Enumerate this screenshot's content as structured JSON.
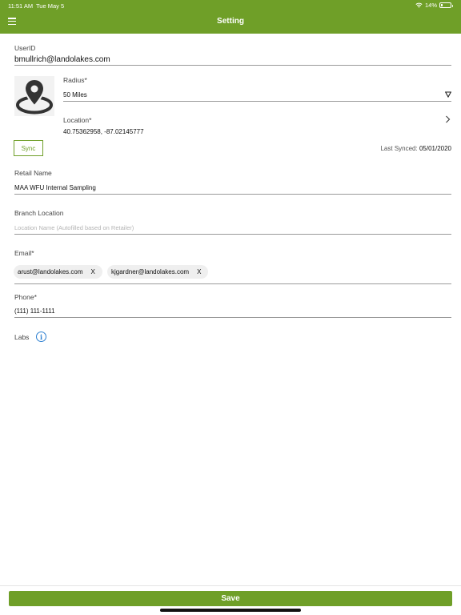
{
  "status_bar": {
    "time": "11:51 AM",
    "date": "Tue May 5",
    "battery": "14%",
    "battery_level": 0.14
  },
  "header": {
    "title": "Setting"
  },
  "user": {
    "label": "UserID",
    "value": "bmullrich@landolakes.com"
  },
  "radius": {
    "label": "Radius*",
    "value": "50 Miles"
  },
  "location": {
    "label": "Location*",
    "value": "40.75362958, -87.02145777"
  },
  "sync": {
    "button_label": "Sync",
    "last_synced_label": "Last Synced:",
    "last_synced_date": "05/01/2020"
  },
  "retail": {
    "label": "Retail Name",
    "value": "MAA WFU Internal Sampling"
  },
  "branch": {
    "label": "Branch Location",
    "placeholder": "Location Name (Autofilled based on Retailer)"
  },
  "email": {
    "label": "Email*",
    "chips": [
      {
        "text": "arust@landolakes.com",
        "remove": "X"
      },
      {
        "text": "kjgardner@landolakes.com",
        "remove": "X"
      }
    ]
  },
  "phone": {
    "label": "Phone*",
    "value": "(111) 111-1111"
  },
  "labs": {
    "label": "Labs",
    "info_icon": "i"
  },
  "footer": {
    "save_label": "Save"
  },
  "colors": {
    "brand_green": "#6f9f28",
    "info_blue": "#2c7fd1"
  }
}
